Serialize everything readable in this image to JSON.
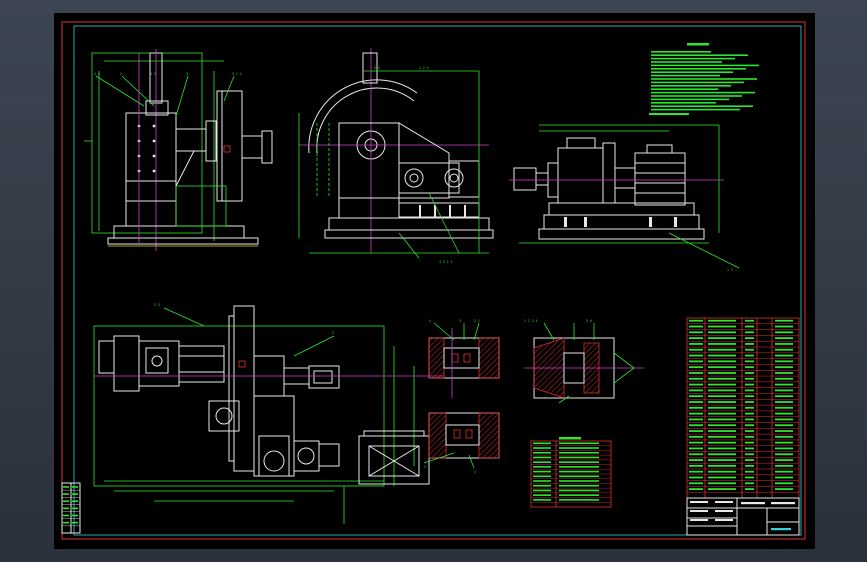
{
  "colors": {
    "background": "#000000",
    "outer_border": "#e03030",
    "inner_border": "#31d0d8",
    "geometry": "#e8e8e8",
    "dimensions": "#2ee62e",
    "hatching": "#e03030",
    "centerlines": "#d040d0"
  },
  "drawing": {
    "views": [
      "front-view",
      "side-view-with-flywheel",
      "end-view-with-motor",
      "top-plan-view",
      "section-detail-upper",
      "section-detail-lower",
      "section-detail-right"
    ]
  },
  "annotations": {
    "leader_labels": [
      "4",
      "2",
      "3",
      "1"
    ],
    "section_letters": [
      "I",
      "2"
    ],
    "dim_text": [
      "2",
      "1",
      "4",
      "3",
      "6"
    ]
  },
  "tables": {
    "parts_list_rows": 30,
    "title_block_rows": 6,
    "spec_table_rows": 14,
    "revision_rows": 7
  }
}
